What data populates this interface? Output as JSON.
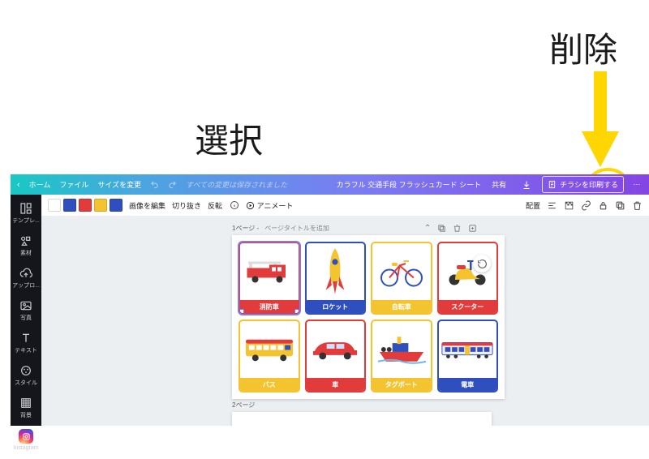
{
  "annotations": {
    "select_label": "選択",
    "delete_label": "削除"
  },
  "header": {
    "home": "ホーム",
    "file": "ファイル",
    "resize": "サイズを変更",
    "autosave": "すべての変更は保存されました",
    "doc_title": "カラフル 交通手段 フラッシュカード シート",
    "share": "共有",
    "print_flyer": "チラシを印刷する"
  },
  "toolbar": {
    "swatches": [
      "#ffffff",
      "#2f4fbf",
      "#e23b3b",
      "#f4c430",
      "#2f4fbf"
    ],
    "edit_image": "画像を編集",
    "crop": "切り抜き",
    "flip": "反転",
    "animate": "アニメート",
    "arrange": "配置"
  },
  "sidebar": {
    "items": [
      {
        "label": "テンプレ..."
      },
      {
        "label": "素材"
      },
      {
        "label": "アップロ..."
      },
      {
        "label": "写真"
      },
      {
        "label": "テキスト"
      },
      {
        "label": "スタイル"
      },
      {
        "label": "背景"
      }
    ]
  },
  "page": {
    "number_prefix": "1ページ - ",
    "title_placeholder": "ページタイトルを追加",
    "cards": [
      {
        "label": "消防車",
        "border": "#e23b3b",
        "band": "#e23b3b"
      },
      {
        "label": "ロケット",
        "border": "#2f4fbf",
        "band": "#2f4fbf"
      },
      {
        "label": "自転車",
        "border": "#f4c430",
        "band": "#f4c430"
      },
      {
        "label": "スクーター",
        "border": "#e23b3b",
        "band": "#e23b3b"
      },
      {
        "label": "バス",
        "border": "#f4c430",
        "band": "#f4c430"
      },
      {
        "label": "車",
        "border": "#e23b3b",
        "band": "#e23b3b"
      },
      {
        "label": "タグボート",
        "border": "#f4c430",
        "band": "#f4c430"
      },
      {
        "label": "電車",
        "border": "#2f4fbf",
        "band": "#2f4fbf"
      }
    ],
    "page2_label": "2ページ"
  }
}
